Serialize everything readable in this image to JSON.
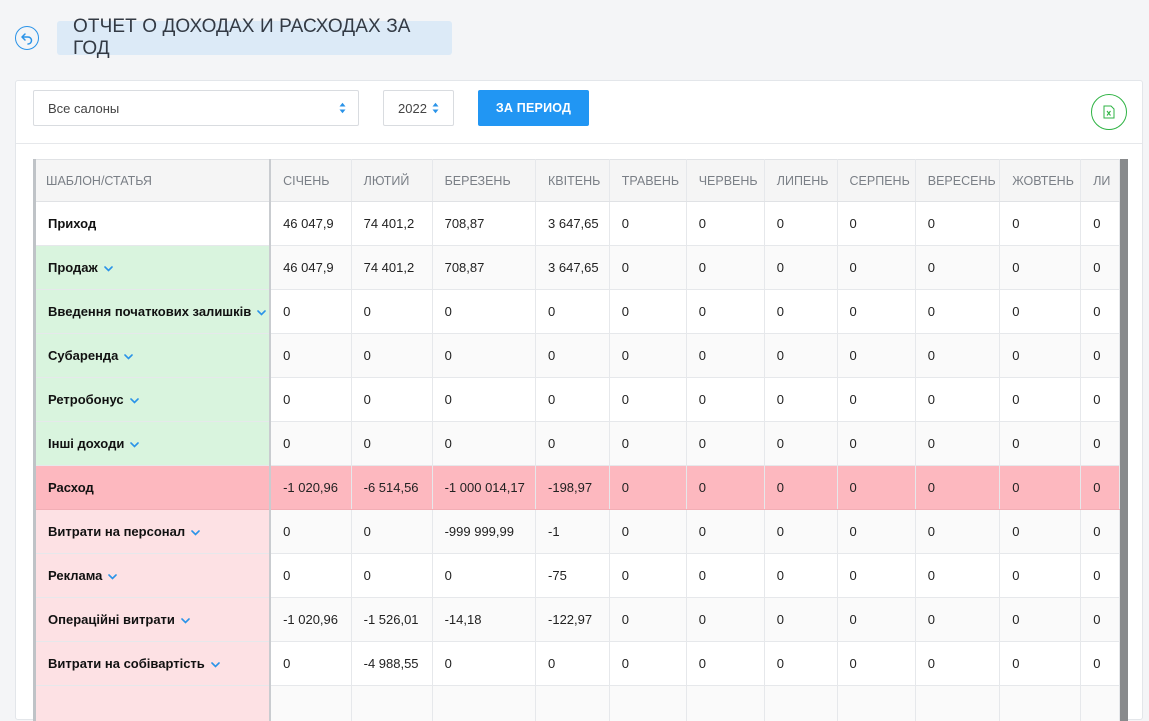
{
  "header": {
    "title": "ОТЧЕТ О ДОХОДАХ И РАСХОДАХ ЗА ГОД"
  },
  "toolbar": {
    "salon_select_value": "Все салоны",
    "year_select_value": "2022",
    "period_button_label": "ЗА ПЕРИОД"
  },
  "colors": {
    "accent": "#2196f3",
    "income_row": "#d9f4de",
    "expense_total_row": "#fdb8bf",
    "expense_row": "#fde1e4",
    "excel": "#2fb344"
  },
  "table": {
    "label_header": "ШАБЛОН/СТАТЬЯ",
    "months": [
      "СІЧЕНЬ",
      "ЛЮТИЙ",
      "БЕРЕЗЕНЬ",
      "КВІТЕНЬ",
      "ТРАВЕНЬ",
      "ЧЕРВЕНЬ",
      "ЛИПЕНЬ",
      "СЕРПЕНЬ",
      "ВЕРЕСЕНЬ",
      "ЖОВТЕНЬ",
      "ЛИ"
    ],
    "rows": [
      {
        "label": "Приход",
        "kind": "income",
        "values": [
          "46 047,9",
          "74 401,2",
          "708,87",
          "3 647,65",
          "0",
          "0",
          "0",
          "0",
          "0",
          "0",
          "0"
        ]
      },
      {
        "label": "Продаж",
        "kind": "inc-sub",
        "values": [
          "46 047,9",
          "74 401,2",
          "708,87",
          "3 647,65",
          "0",
          "0",
          "0",
          "0",
          "0",
          "0",
          "0"
        ]
      },
      {
        "label": "Введення початкових залишків",
        "kind": "inc-sub",
        "values": [
          "0",
          "0",
          "0",
          "0",
          "0",
          "0",
          "0",
          "0",
          "0",
          "0",
          "0"
        ]
      },
      {
        "label": "Субаренда",
        "kind": "inc-sub",
        "values": [
          "0",
          "0",
          "0",
          "0",
          "0",
          "0",
          "0",
          "0",
          "0",
          "0",
          "0"
        ]
      },
      {
        "label": "Ретробонус",
        "kind": "inc-sub",
        "values": [
          "0",
          "0",
          "0",
          "0",
          "0",
          "0",
          "0",
          "0",
          "0",
          "0",
          "0"
        ]
      },
      {
        "label": "Інші доходи",
        "kind": "inc-sub",
        "values": [
          "0",
          "0",
          "0",
          "0",
          "0",
          "0",
          "0",
          "0",
          "0",
          "0",
          "0"
        ]
      },
      {
        "label": "Расход",
        "kind": "expense",
        "values": [
          "-1 020,96",
          "-6 514,56",
          "-1 000 014,17",
          "-198,97",
          "0",
          "0",
          "0",
          "0",
          "0",
          "0",
          "0"
        ]
      },
      {
        "label": "Витрати на персонал",
        "kind": "exp-sub",
        "values": [
          "0",
          "0",
          "-999 999,99",
          "-1",
          "0",
          "0",
          "0",
          "0",
          "0",
          "0",
          "0"
        ]
      },
      {
        "label": "Реклама",
        "kind": "exp-sub",
        "values": [
          "0",
          "0",
          "0",
          "-75",
          "0",
          "0",
          "0",
          "0",
          "0",
          "0",
          "0"
        ]
      },
      {
        "label": "Операційні витрати",
        "kind": "exp-sub",
        "values": [
          "-1 020,96",
          "-1 526,01",
          "-14,18",
          "-122,97",
          "0",
          "0",
          "0",
          "0",
          "0",
          "0",
          "0"
        ]
      },
      {
        "label": "Витрати на собівартість",
        "kind": "exp-sub",
        "values": [
          "0",
          "-4 988,55",
          "0",
          "0",
          "0",
          "0",
          "0",
          "0",
          "0",
          "0",
          "0"
        ]
      },
      {
        "label": "",
        "kind": "exp-sub",
        "values": [
          "",
          "",
          "",
          "",
          "",
          "",
          "",
          "",
          "",
          "",
          ""
        ]
      }
    ]
  }
}
